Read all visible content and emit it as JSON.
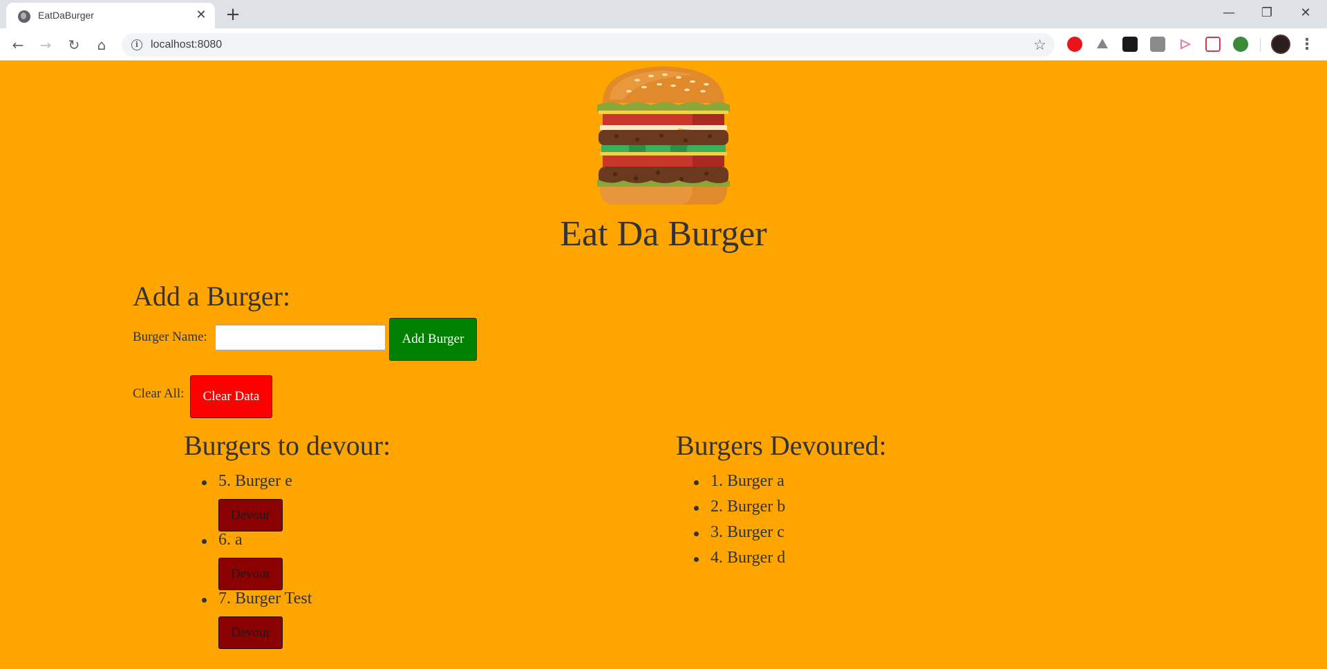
{
  "browser": {
    "tab_title": "EatDaBurger",
    "tab_close": "✕",
    "new_tab": "+",
    "url": "localhost:8080",
    "window_controls": {
      "minimize": "—",
      "restore": "❐",
      "close": "✕"
    },
    "nav": {
      "back": "←",
      "forward": "→",
      "reload": "↻",
      "home": "⌂"
    },
    "extensions": [
      "adblock-icon",
      "drive-icon",
      "blackberry-icon",
      "screen-capture-icon",
      "cast-icon",
      "pocket-icon",
      "globe-ext-icon"
    ],
    "accent_colors": {
      "adblock": "#e8161b",
      "drive": "#80868b",
      "blackberry": "#1a1a1a",
      "capture": "#8a8a8a",
      "cast": "#f07aa0",
      "pocket": "#d3374b",
      "globe": "#3a8a3a"
    }
  },
  "page": {
    "title": "Eat Da Burger",
    "add_section": {
      "heading": "Add a Burger:",
      "name_label": "Burger Name:",
      "name_value": "",
      "add_button": "Add Burger",
      "clear_label": "Clear All:",
      "clear_button": "Clear Data"
    },
    "to_devour": {
      "heading": "Burgers to devour:",
      "items": [
        {
          "name": "5. Burger e",
          "button": "Devour"
        },
        {
          "name": "6. a",
          "button": "Devour"
        },
        {
          "name": "7. Burger Test",
          "button": "Devour"
        }
      ]
    },
    "devoured": {
      "heading": "Burgers Devoured:",
      "items": [
        {
          "name": "1. Burger a"
        },
        {
          "name": "2. Burger b"
        },
        {
          "name": "3. Burger c"
        },
        {
          "name": "4. Burger d"
        }
      ]
    },
    "colors": {
      "background": "#ffa500",
      "add_button": "#008000",
      "clear_button": "#ff0000",
      "devour_button": "#8b0000"
    }
  }
}
